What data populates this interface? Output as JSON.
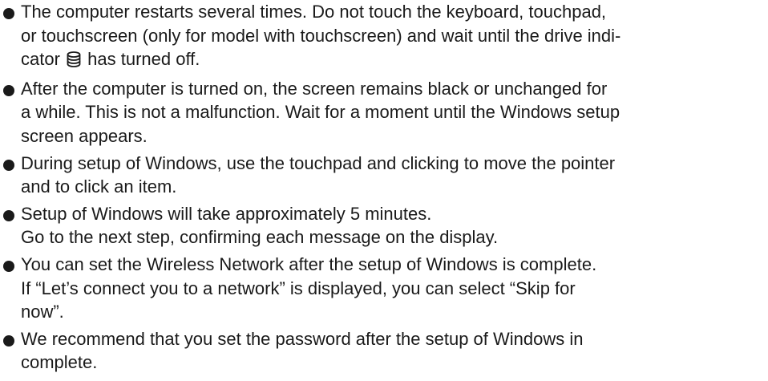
{
  "bullets": [
    {
      "lines": [
        "The computer restarts several times. Do not touch the keyboard, touchpad,",
        "or touchscreen (only for model with touchscreen) and wait until the drive indi-"
      ],
      "icon_line": {
        "before": "cator ",
        "icon": "drive-indicator-icon",
        "after": " has turned off."
      }
    },
    {
      "lines": [
        "After the computer is turned on, the screen remains black or unchanged for",
        "a while. This is not a malfunction. Wait for a moment until the Windows setup",
        "screen appears."
      ]
    },
    {
      "lines": [
        "During setup of Windows, use the touchpad and clicking to move the pointer",
        "and to click an item."
      ]
    },
    {
      "lines": [
        "Setup of Windows will take approximately 5 minutes.",
        "Go to the next step, confirming each message on the display."
      ]
    },
    {
      "lines": [
        "You can set the Wireless Network after the setup of Windows is complete.",
        "If “Let’s connect you to a network” is displayed, you can select “Skip for",
        "now”."
      ]
    },
    {
      "lines": [
        "We recommend that you set the password after the setup of Windows in",
        "complete."
      ]
    }
  ]
}
